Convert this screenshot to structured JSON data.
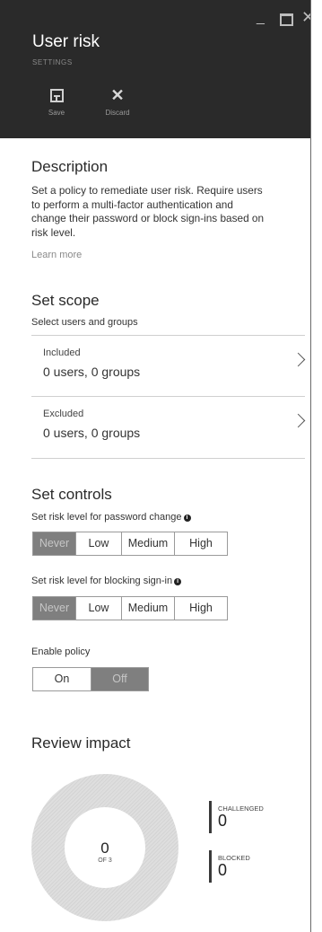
{
  "header": {
    "title": "User risk",
    "subtitle": "SETTINGS",
    "save_label": "Save",
    "discard_label": "Discard",
    "background": "#2a2a2a"
  },
  "description": {
    "heading": "Description",
    "lines": [
      "Set a policy to remediate user risk. Require users",
      "to perform a multi-factor authentication and",
      "change their password or block sign-ins based on",
      "risk level."
    ],
    "learn_more": "Learn more"
  },
  "scope": {
    "heading": "Set scope",
    "subheading": "Select users and groups",
    "included": {
      "label": "Included",
      "value": "0 users, 0 groups"
    },
    "excluded": {
      "label": "Excluded",
      "value": "0 users, 0 groups"
    }
  },
  "controls": {
    "heading": "Set controls",
    "password_change": {
      "label": "Set risk level for password change",
      "options": [
        "Never",
        "Low",
        "Medium",
        "High"
      ],
      "selected": "Never"
    },
    "blocking": {
      "label": "Set risk level for blocking sign-in",
      "options": [
        "Never",
        "Low",
        "Medium",
        "High"
      ],
      "selected": "Never"
    },
    "enable_policy": {
      "label": "Enable policy",
      "options": [
        "On",
        "Off"
      ],
      "selected": "Off"
    }
  },
  "impact": {
    "heading": "Review impact",
    "donut_value": "0",
    "donut_sub": "OF 3",
    "challenged_label": "CHALLENGED",
    "challenged_value": "0",
    "blocked_label": "BLOCKED",
    "blocked_value": "0"
  },
  "colors": {
    "selected_segment": "#7f7f7f",
    "accent_dark": "#2a2a2a"
  }
}
